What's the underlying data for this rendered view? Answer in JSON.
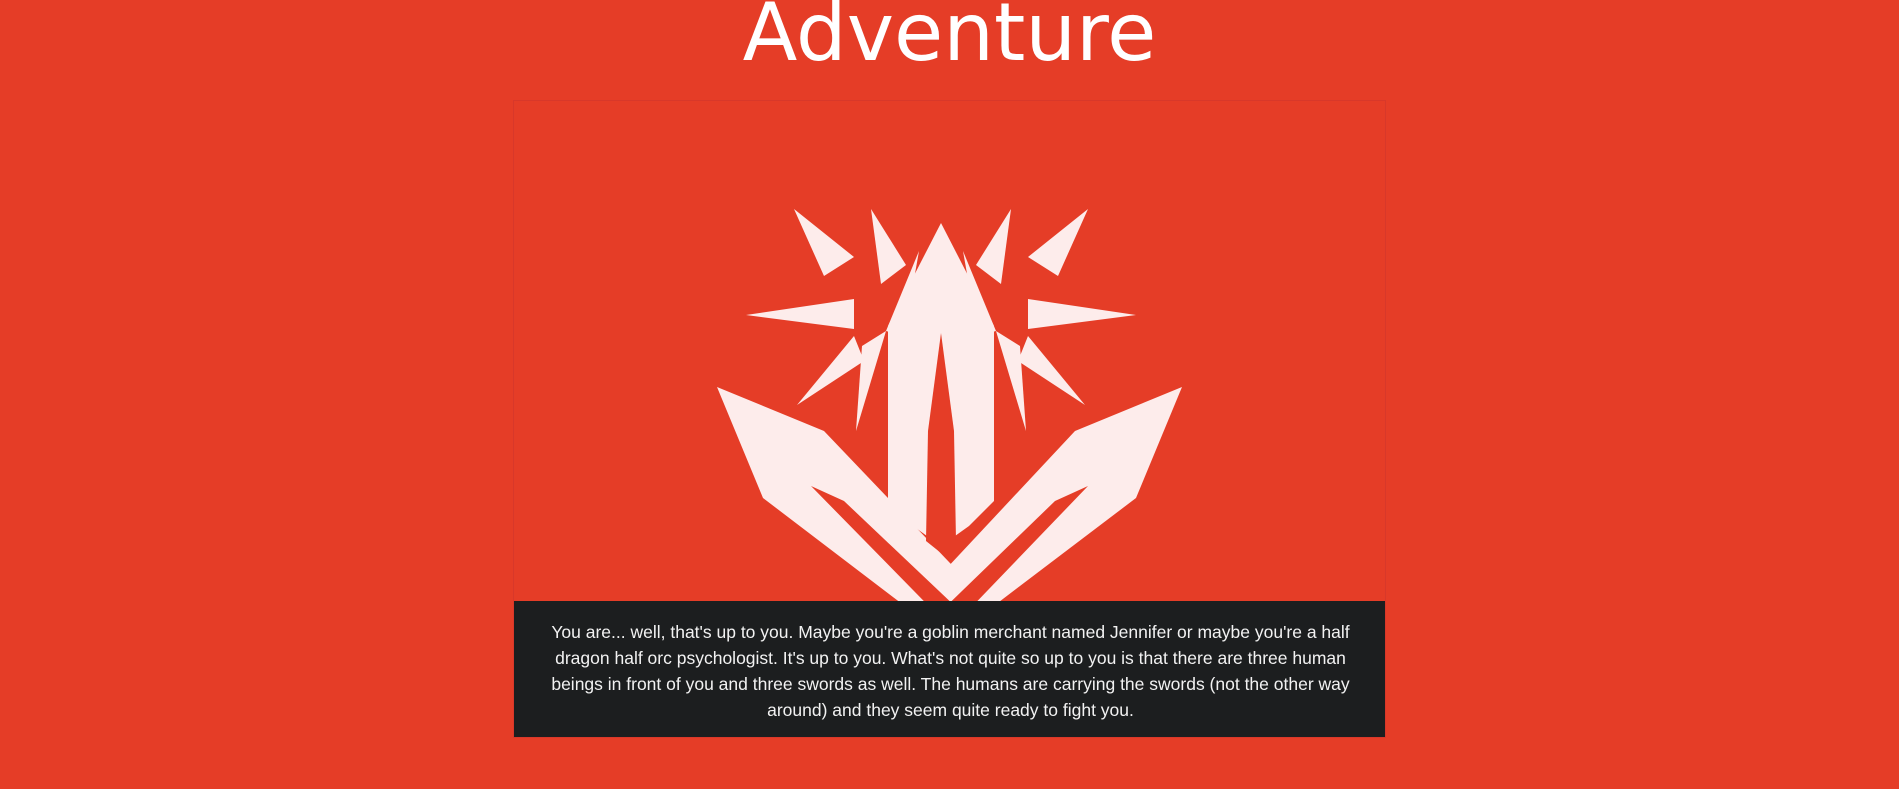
{
  "page": {
    "title": "Adventure"
  },
  "card": {
    "image_icon": "crossed-swords-starburst-icon",
    "description": "You are... well, that's up to you. Maybe you're a goblin merchant named Jennifer or maybe you're a half dragon half orc psychologist. It's up to you. What's not quite so up to you is that there are three human beings in front of you and three swords as well. The humans are carrying the swords (not the other way around) and they seem quite ready to fight you."
  },
  "colors": {
    "background": "#e53d27",
    "icon_fill": "#fdeceb",
    "caption_background": "#1c1e1f",
    "caption_text": "#f2f2f2"
  }
}
